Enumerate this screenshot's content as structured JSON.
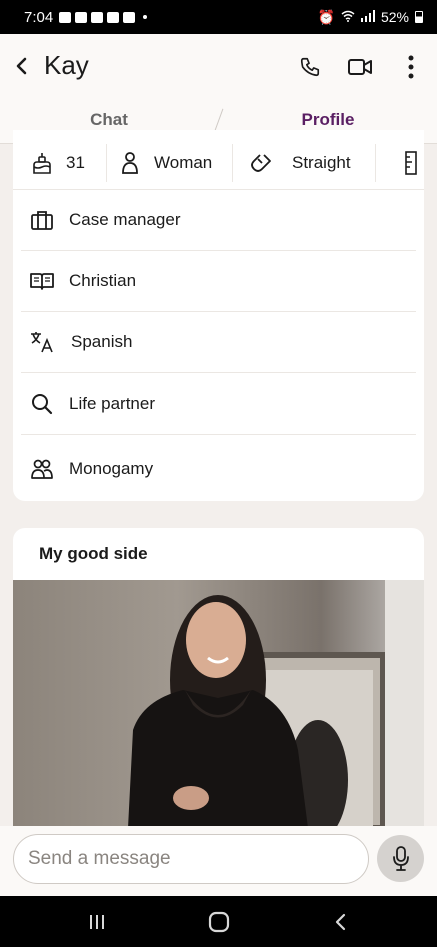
{
  "status_bar": {
    "time": "7:04",
    "battery": "52%"
  },
  "header": {
    "title": "Kay"
  },
  "tabs": {
    "chat": "Chat",
    "profile": "Profile"
  },
  "stats": {
    "age": "31",
    "gender": "Woman",
    "orientation": "Straight"
  },
  "details": [
    {
      "label": "Case manager",
      "icon": "briefcase-icon"
    },
    {
      "label": "Christian",
      "icon": "book-icon"
    },
    {
      "label": "Spanish",
      "icon": "translate-icon"
    },
    {
      "label": "Life partner",
      "icon": "search-icon"
    },
    {
      "label": "Monogamy",
      "icon": "people-icon"
    }
  ],
  "photo_card": {
    "title": "My good side"
  },
  "composer": {
    "placeholder": "Send a message"
  },
  "colors": {
    "accent": "#5a1f63",
    "background": "#f3efec"
  }
}
